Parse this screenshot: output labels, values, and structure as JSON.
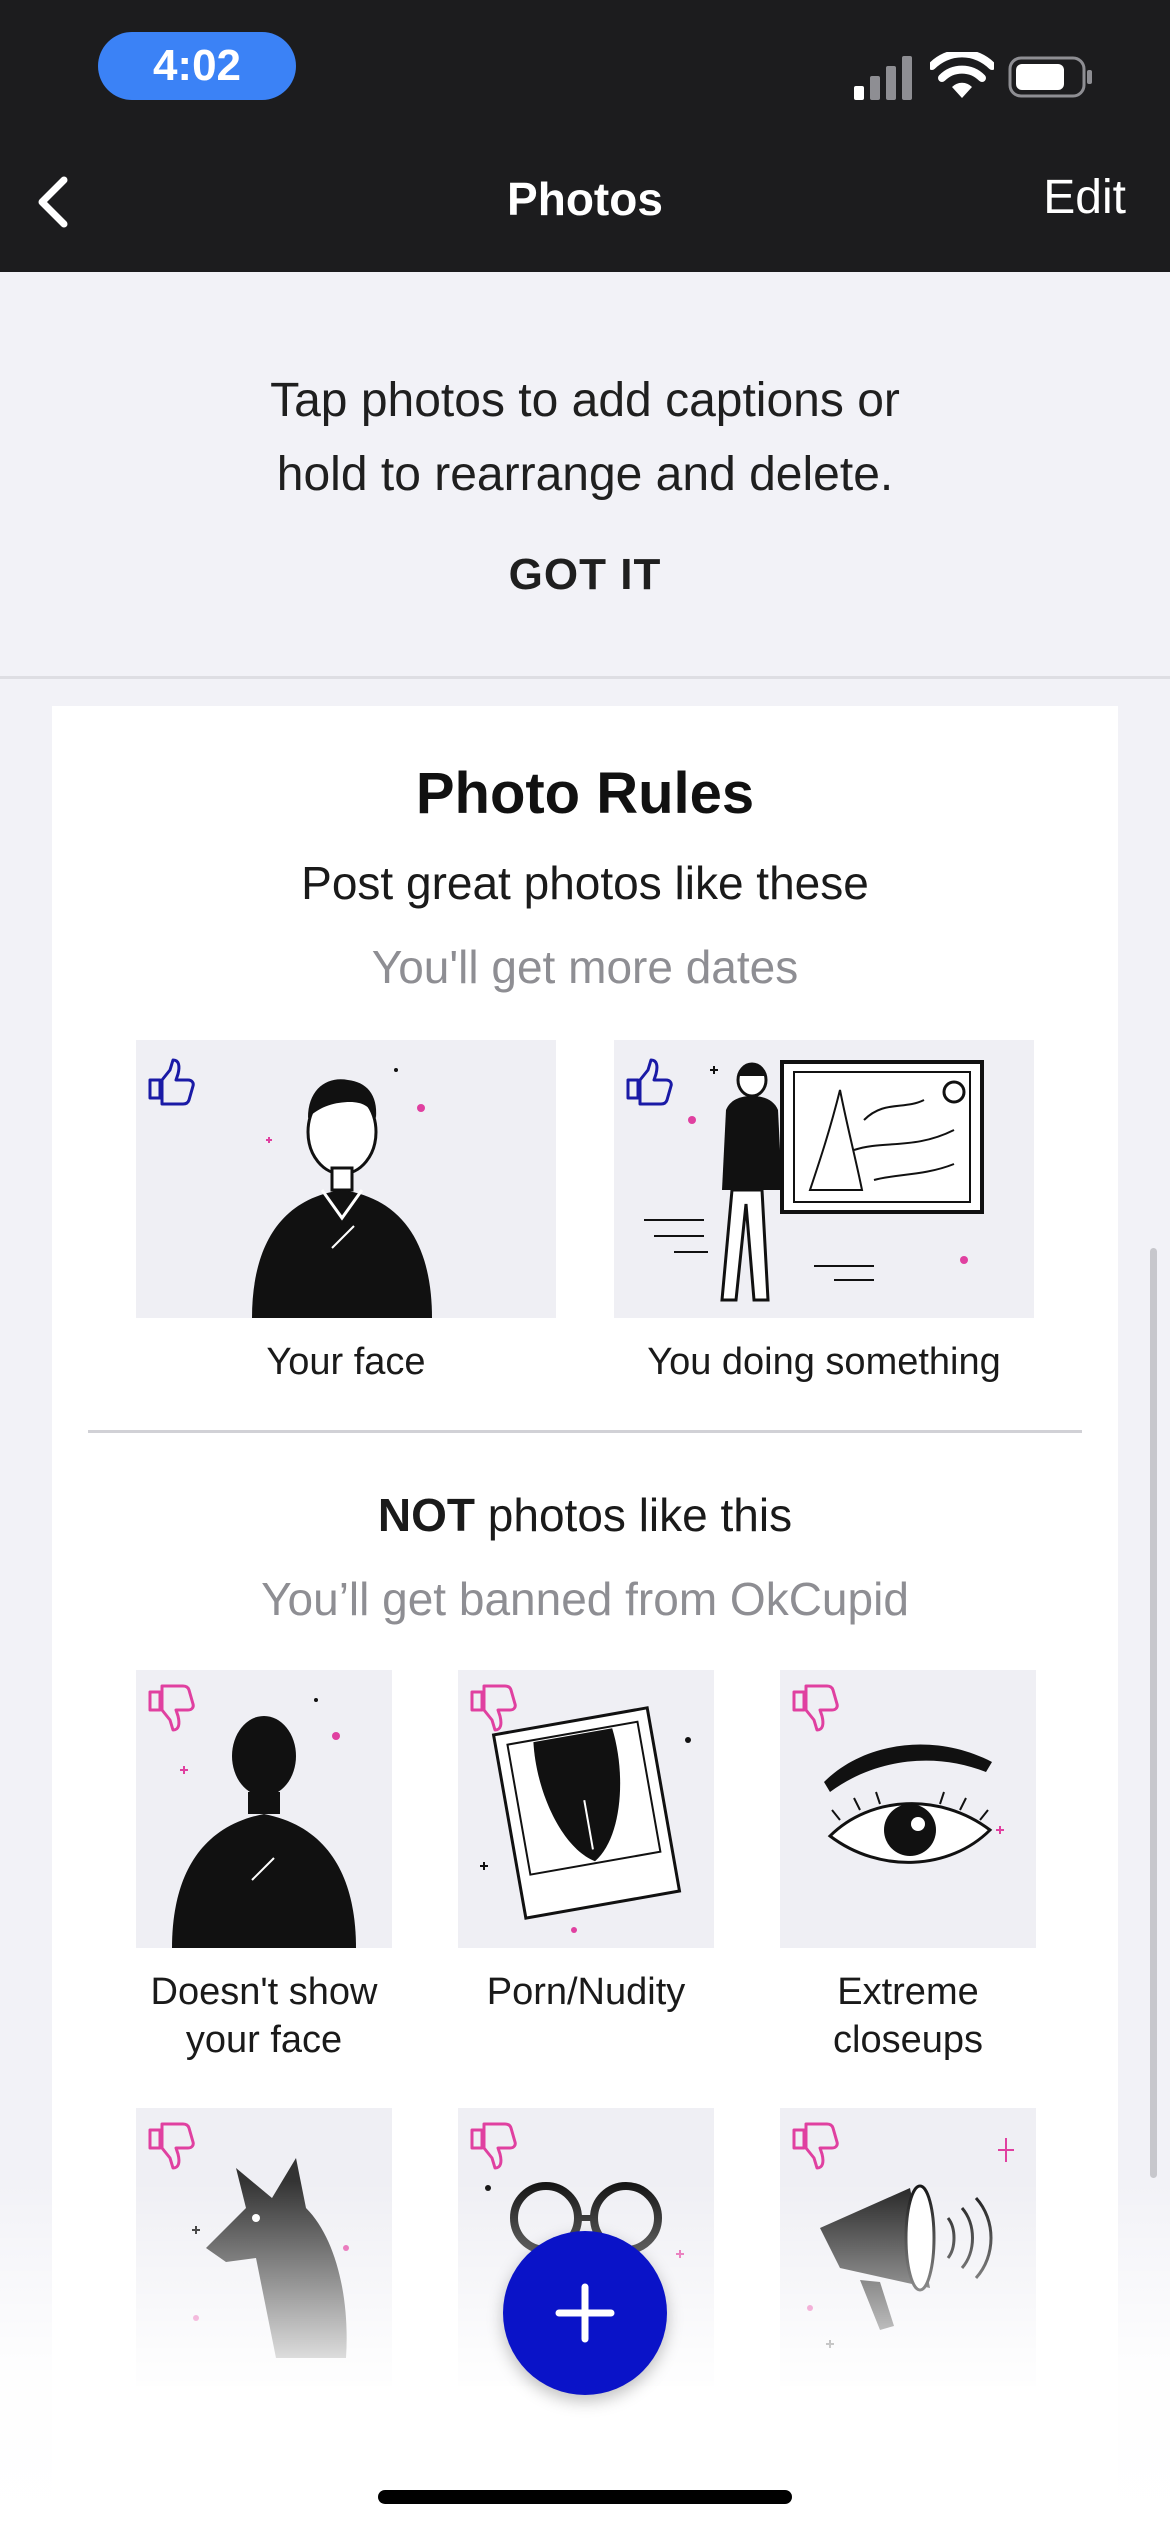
{
  "status_bar": {
    "time": "4:02"
  },
  "nav": {
    "title": "Photos",
    "edit_label": "Edit"
  },
  "tip": {
    "line1": "Tap photos to add captions or",
    "line2": "hold to rearrange and delete.",
    "button": "GOT IT"
  },
  "rules": {
    "title": "Photo Rules",
    "good_heading": "Post great photos like these",
    "good_hint": "You'll get more dates",
    "good_examples": [
      {
        "label": "Your face",
        "icon": "thumbs-up-icon"
      },
      {
        "label": "You doing something",
        "icon": "thumbs-up-icon"
      }
    ],
    "bad_heading_bold": "NOT",
    "bad_heading_rest": " photos like this",
    "bad_hint": "You’ll get banned from OkCupid",
    "bad_examples": [
      {
        "label_line1": "Doesn't show",
        "label_line2": "your face",
        "icon": "thumbs-down-icon"
      },
      {
        "label_line1": "Porn/Nudity",
        "label_line2": "",
        "icon": "thumbs-down-icon"
      },
      {
        "label_line1": "Extreme",
        "label_line2": "closeups",
        "icon": "thumbs-down-icon"
      },
      {
        "label_line1": "",
        "label_line2": "",
        "icon": "thumbs-down-icon"
      },
      {
        "label_line1": "",
        "label_line2": "",
        "icon": "thumbs-down-icon"
      },
      {
        "label_line1": "",
        "label_line2": "",
        "icon": "thumbs-down-icon"
      }
    ]
  },
  "fab": {
    "icon": "plus-icon"
  },
  "colors": {
    "accent": "#0a13c8",
    "good": "#1a1aa6",
    "bad": "#e040a0"
  }
}
